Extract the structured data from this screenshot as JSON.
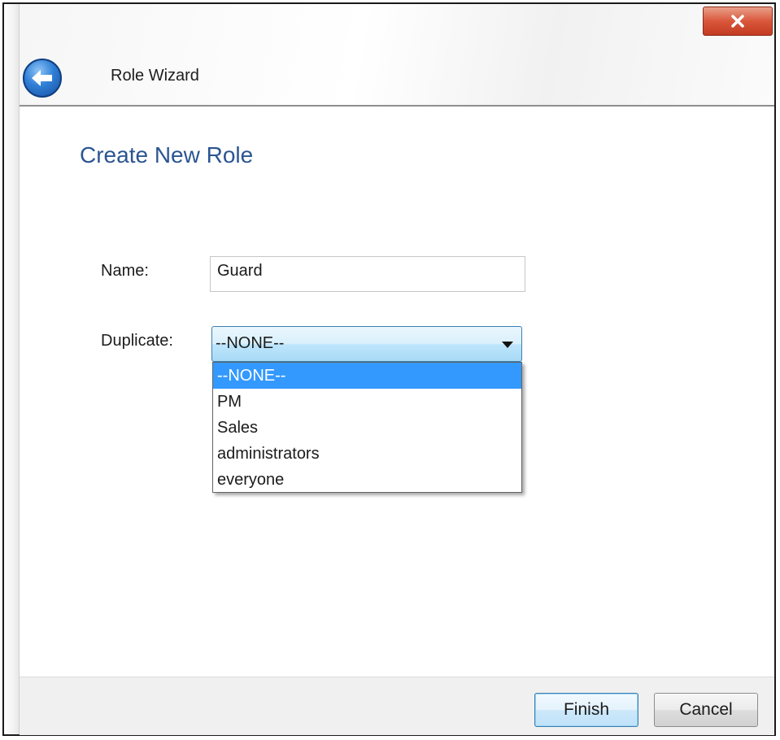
{
  "window": {
    "title": "Role Wizard",
    "close_icon": "close-icon",
    "back_icon": "back-arrow-icon"
  },
  "page": {
    "heading": "Create New Role"
  },
  "form": {
    "name_label": "Name:",
    "name_value": "Guard",
    "duplicate_label": "Duplicate:",
    "duplicate_selected": "--NONE--",
    "duplicate_options": [
      "--NONE--",
      "PM",
      "Sales",
      "administrators",
      "everyone"
    ]
  },
  "footer": {
    "finish_label": "Finish",
    "cancel_label": "Cancel"
  },
  "colors": {
    "heading": "#2b5592",
    "selection": "#3399ff",
    "close_button": "#d9573b"
  }
}
